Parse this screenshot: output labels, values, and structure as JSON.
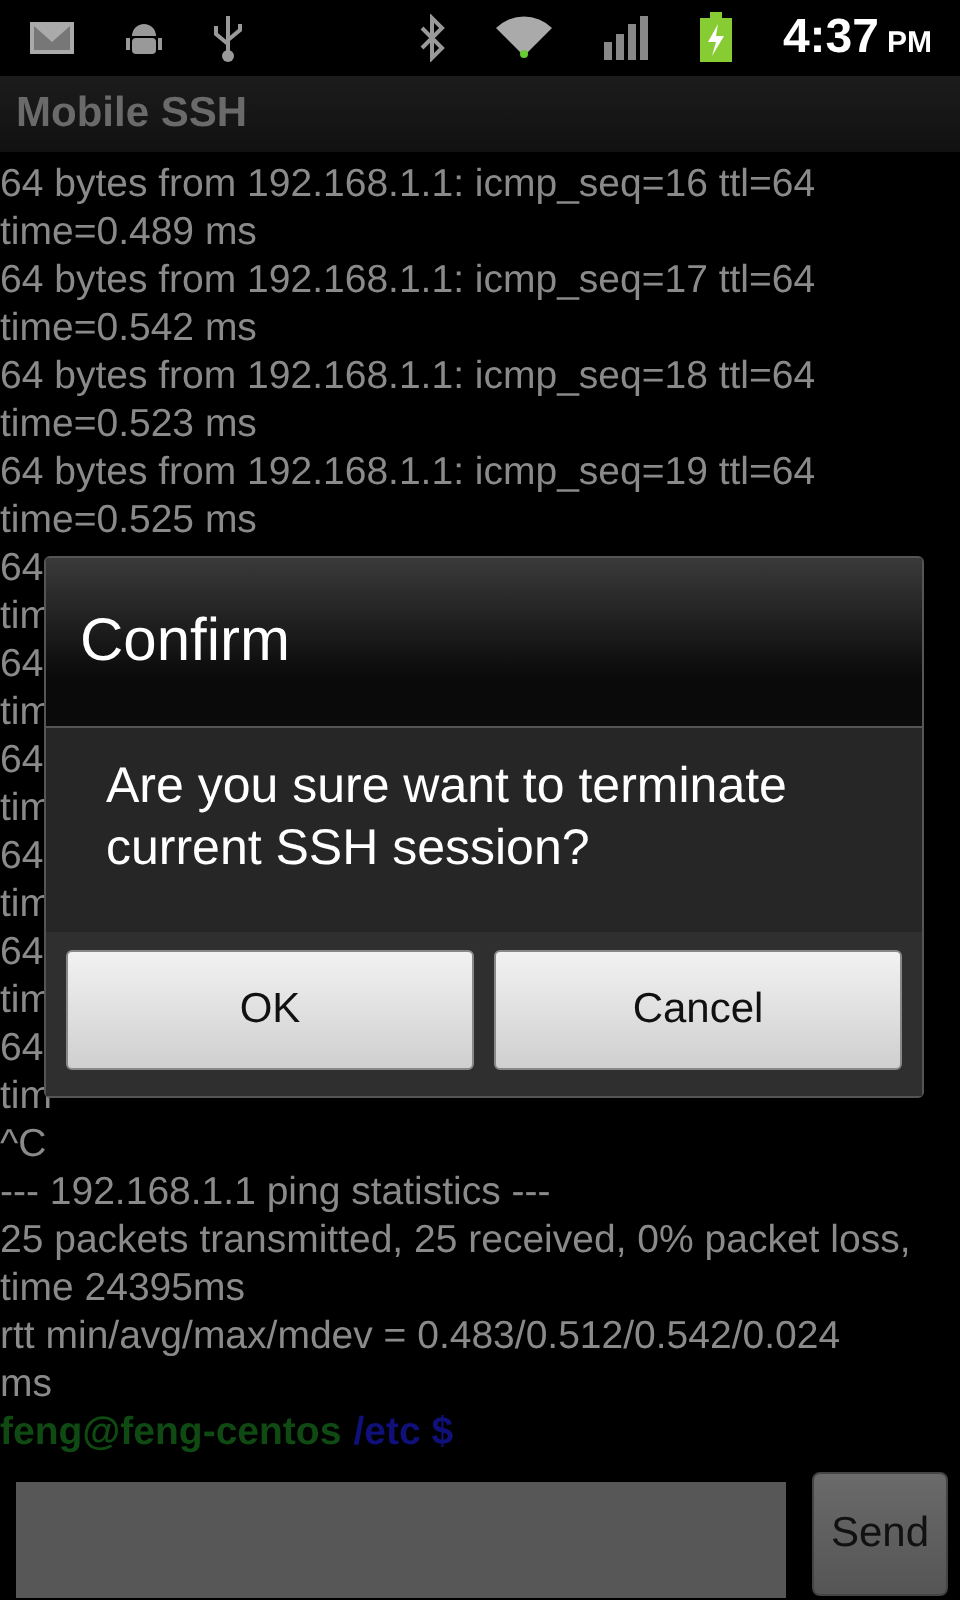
{
  "status_bar": {
    "time": "4:37",
    "meridiem": "PM"
  },
  "app_bar": {
    "title": "Mobile SSH"
  },
  "terminal": {
    "lines": [
      "64 bytes from 192.168.1.1: icmp_seq=16 ttl=64",
      "time=0.489 ms",
      "64 bytes from 192.168.1.1: icmp_seq=17 ttl=64",
      "time=0.542 ms",
      "64 bytes from 192.168.1.1: icmp_seq=18 ttl=64",
      "time=0.523 ms",
      "64 bytes from 192.168.1.1: icmp_seq=19 ttl=64",
      "time=0.525 ms",
      "64",
      "tim",
      "64",
      "tim",
      "64",
      "tim",
      "64",
      "tim",
      "64",
      "tim",
      "64",
      "tim",
      "^C",
      "--- 192.168.1.1 ping statistics ---",
      "25 packets transmitted, 25 received, 0% packet loss,",
      "time 24395ms",
      "rtt min/avg/max/mdev = 0.483/0.512/0.542/0.024",
      "ms"
    ],
    "prompt": {
      "user_host": "feng@feng-centos",
      "path": "/etc $"
    }
  },
  "dialog": {
    "title": "Confirm",
    "message": "Are you sure want to terminate current SSH session?",
    "buttons": [
      "OK",
      "Cancel"
    ]
  },
  "command_bar": {
    "send": "Send"
  }
}
